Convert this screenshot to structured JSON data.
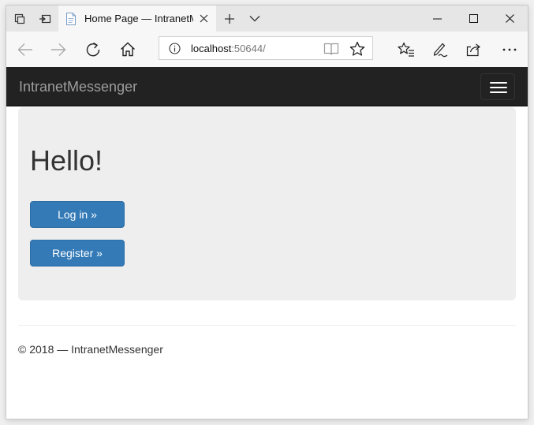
{
  "browser": {
    "tab": {
      "title": "Home Page — IntranetMessenger"
    },
    "address": {
      "host": "localhost",
      "port": ":50644/"
    }
  },
  "site": {
    "brand": "IntranetMessenger",
    "heading": "Hello!",
    "buttons": {
      "login": "Log in »",
      "register": "Register »"
    },
    "footer": "© 2018 — IntranetMessenger"
  },
  "icons": {
    "tab_actions": [
      "set-aside-tabs-icon",
      "tab-preview-icon"
    ],
    "tab": [
      "page-favicon-icon",
      "close-icon"
    ],
    "tab_bar": [
      "new-tab-icon",
      "tab-list-chevron-icon"
    ],
    "window": [
      "minimize-icon",
      "maximize-icon",
      "window-close-icon"
    ],
    "toolbar": [
      "back-arrow-icon",
      "forward-arrow-icon",
      "refresh-icon",
      "home-icon",
      "favorites-icon",
      "pen-icon",
      "share-icon",
      "more-icon"
    ],
    "address": [
      "info-icon",
      "reading-view-icon",
      "star-icon"
    ],
    "navbar": [
      "hamburger-menu-icon"
    ]
  },
  "colors": {
    "navbar_bg": "#222222",
    "brand_text": "#9d9d9d",
    "jumbotron_bg": "#eeeeee",
    "primary_button": "#337ab7"
  }
}
